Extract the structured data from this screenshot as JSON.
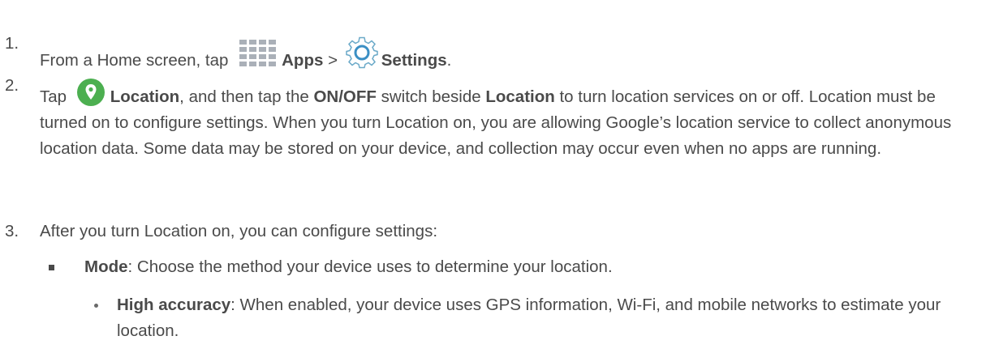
{
  "steps": [
    {
      "num": "1.",
      "t1": "From a Home screen, tap ",
      "apps": "Apps",
      "sep": " > ",
      "settings": "Settings",
      "t2": "."
    },
    {
      "num": "2.",
      "t1": "Tap ",
      "location": "Location",
      "t2": ", and then tap the ",
      "onoff": "ON/OFF",
      "t3": " switch beside ",
      "location2": "Location",
      "t4": " to turn location services on or off. Location must be turned on to configure settings. When you turn Location on, you are allowing Google’s location service to collect anonymous location data. Some data may be stored on your device, and collection may occur even when no apps are running."
    },
    {
      "num": "3.",
      "text": "After you turn Location on, you can configure settings:"
    }
  ],
  "bullets": [
    {
      "label": "Mode",
      "text": ": Choose the method your device uses to determine your location."
    }
  ],
  "subbullets": [
    {
      "label": "High accuracy",
      "text": ": When enabled, your device uses GPS information, Wi-Fi, and mobile networks to estimate your location."
    }
  ],
  "icons": {
    "apps": "apps-grid-icon",
    "settings": "settings-gear-icon",
    "location": "location-pin-icon"
  },
  "colors": {
    "text": "#4a4a4a",
    "location_icon": "#4caf50"
  }
}
